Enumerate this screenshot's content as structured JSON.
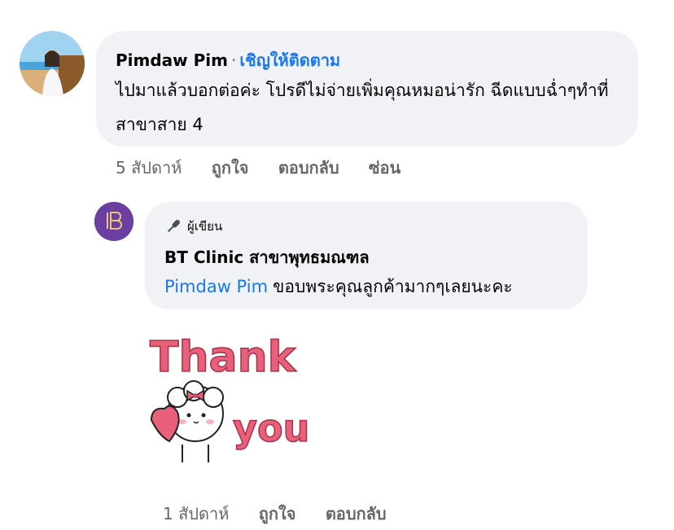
{
  "comment1": {
    "author": "Pimdaw Pim",
    "separator": "·",
    "follow_label": "เชิญให้ติดตาม",
    "text": "ไปมาแล้วบอกต่อค่ะ โปรดีไม่จ่ายเพิ่มคุณหมอน่ารัก ฉีดแบบฉ่ำๆทำที่สาขาสาย 4",
    "time": "5 สัปดาห์",
    "like_label": "ถูกใจ",
    "reply_label": "ตอบกลับ",
    "hide_label": "ซ่อน"
  },
  "reply1": {
    "author_badge": "ผู้เขียน",
    "author": "BT Clinic สาขาพุทธมณฑล",
    "mention": "Pimdaw Pim",
    "text": "ขอบพระคุณลูกค้ามากๆเลยนะคะ",
    "sticker_text_top": "Thank",
    "sticker_text_bottom": "you",
    "time": "1 สัปดาห์",
    "like_label": "ถูกใจ",
    "reply_label": "ตอบกลับ"
  },
  "colors": {
    "bubble": "#f0f2f5",
    "link": "#1877f2",
    "meta": "#65676b",
    "sticker_pink": "#e8607a"
  }
}
